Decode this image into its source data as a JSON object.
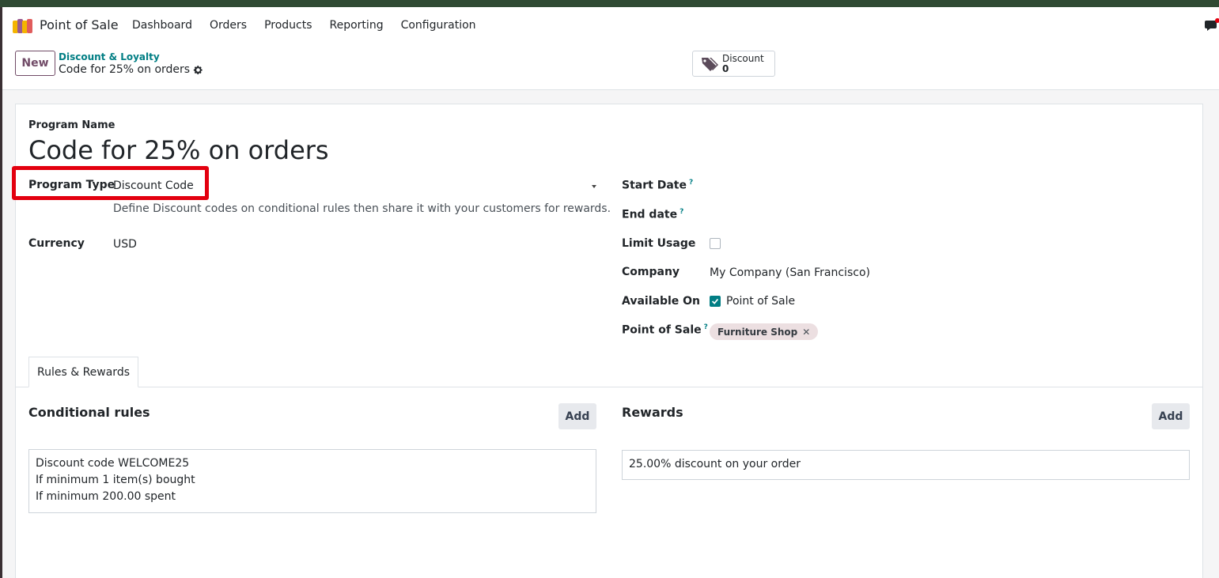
{
  "navbar": {
    "app_name": "Point of Sale",
    "menu": [
      "Dashboard",
      "Orders",
      "Products",
      "Reporting",
      "Configuration"
    ]
  },
  "control_panel": {
    "new_label": "New",
    "breadcrumb_parent": "Discount & Loyalty",
    "breadcrumb_current": "Code for 25% on orders",
    "smart_button": {
      "label": "Discount",
      "count": "0"
    }
  },
  "form": {
    "program_name_label": "Program Name",
    "program_name": "Code for 25% on orders",
    "program_type_label": "Program Type",
    "program_type_value": "Discount Code",
    "program_type_desc": "Define Discount codes on conditional rules then share it with your customers for rewards.",
    "currency_label": "Currency",
    "currency_value": "USD",
    "start_date_label": "Start Date",
    "end_date_label": "End date",
    "limit_usage_label": "Limit Usage",
    "company_label": "Company",
    "company_value": "My Company (San Francisco)",
    "available_on_label": "Available On",
    "available_on_option": "Point of Sale",
    "pos_label": "Point of Sale",
    "pos_tag": "Furniture Shop",
    "help_mark": "?"
  },
  "tabs": [
    "Rules & Rewards"
  ],
  "rules": {
    "title": "Conditional rules",
    "add_label": "Add",
    "lines": [
      "Discount code WELCOME25",
      "If minimum 1 item(s) bought",
      "If minimum 200.00 spent"
    ]
  },
  "rewards": {
    "title": "Rewards",
    "add_label": "Add",
    "lines": [
      "25.00% discount on your order"
    ]
  },
  "colors": {
    "accent": "#714b67",
    "teal": "#017e84",
    "highlight": "#e3000f"
  }
}
